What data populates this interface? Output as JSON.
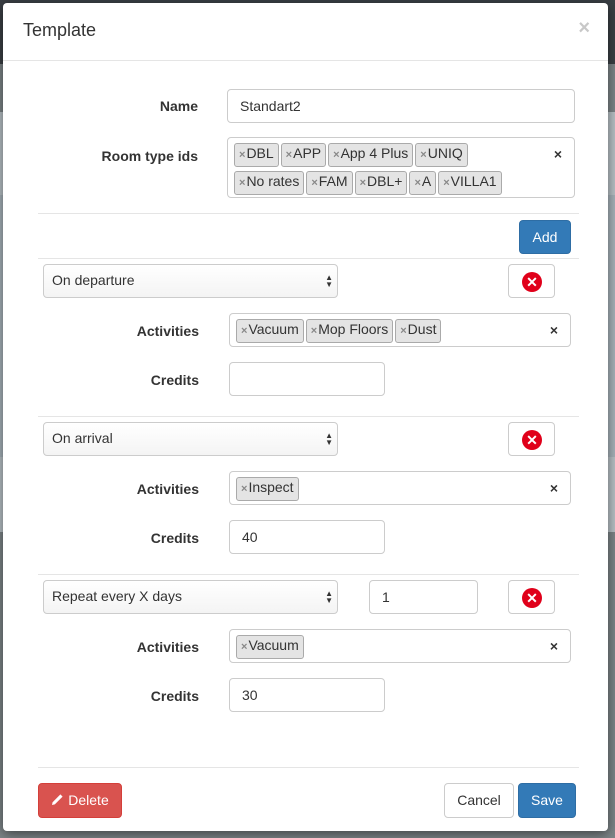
{
  "modal": {
    "title": "Template",
    "close_glyph": "×"
  },
  "name": {
    "label": "Name",
    "value": "Standart2"
  },
  "room_types": {
    "label": "Room type ids",
    "tags": [
      "DBL",
      "APP",
      "App 4 Plus",
      "UNIQ",
      "No rates",
      "FAM",
      "DBL+",
      "A",
      "VILLA1"
    ]
  },
  "add_label": "Add",
  "rules": [
    {
      "trigger": "On departure",
      "activities_label": "Activities",
      "activities": [
        "Vacuum",
        "Mop Floors",
        "Dust"
      ],
      "credits_label": "Credits",
      "credits": ""
    },
    {
      "trigger": "On arrival",
      "activities_label": "Activities",
      "activities": [
        "Inspect"
      ],
      "credits_label": "Credits",
      "credits": "40"
    },
    {
      "trigger": "Repeat every X days",
      "interval": "1",
      "activities_label": "Activities",
      "activities": [
        "Vacuum"
      ],
      "credits_label": "Credits",
      "credits": "30"
    }
  ],
  "footer": {
    "delete_label": "Delete",
    "cancel_label": "Cancel",
    "save_label": "Save"
  },
  "colors": {
    "primary": "#337ab7",
    "danger": "#d9534f",
    "remove_icon": "#e0001a"
  }
}
